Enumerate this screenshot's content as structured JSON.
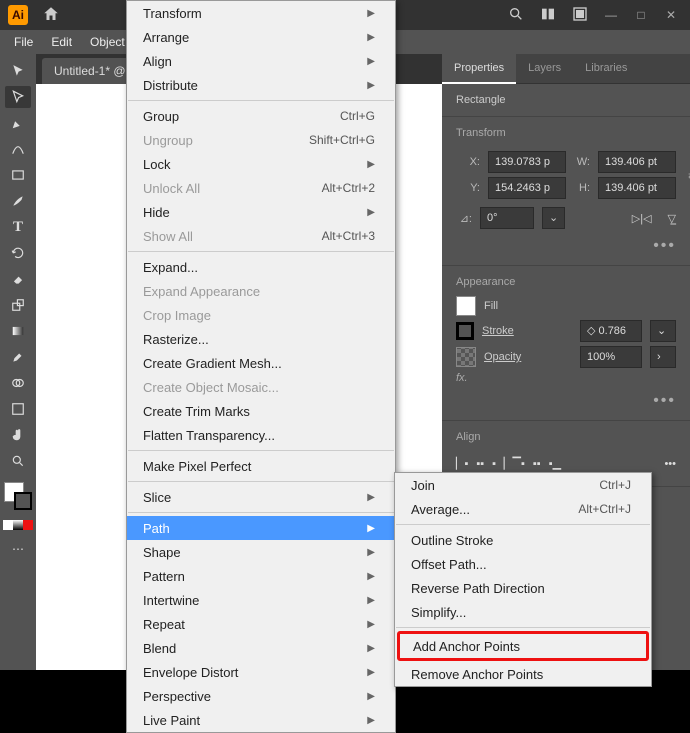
{
  "titlebar": {
    "logo_text": "Ai"
  },
  "menubar": {
    "items": [
      "File",
      "Edit",
      "Object"
    ]
  },
  "doc_tab": "Untitled-1* @",
  "panel": {
    "tabs": [
      "Properties",
      "Layers",
      "Libraries"
    ],
    "shape_type": "Rectangle",
    "transform": {
      "title": "Transform",
      "x_label": "X:",
      "x": "139.0783 p",
      "y_label": "Y:",
      "y": "154.2463 p",
      "w_label": "W:",
      "w": "139.406 pt",
      "h_label": "H:",
      "h": "139.406 pt",
      "angle_label": "⊿:",
      "angle": "0°"
    },
    "appearance": {
      "title": "Appearance",
      "fill": "Fill",
      "stroke": "Stroke",
      "stroke_val": "0.786",
      "opacity": "Opacity",
      "opacity_val": "100%",
      "fx": "fx."
    },
    "align": {
      "title": "Align"
    }
  },
  "main_menu": [
    {
      "label": "Transform",
      "sub": true
    },
    {
      "label": "Arrange",
      "sub": true
    },
    {
      "label": "Align",
      "sub": true
    },
    {
      "label": "Distribute",
      "sub": true
    },
    {
      "sep": true
    },
    {
      "label": "Group",
      "shortcut": "Ctrl+G"
    },
    {
      "label": "Ungroup",
      "shortcut": "Shift+Ctrl+G",
      "disabled": true
    },
    {
      "label": "Lock",
      "sub": true
    },
    {
      "label": "Unlock All",
      "shortcut": "Alt+Ctrl+2",
      "disabled": true
    },
    {
      "label": "Hide",
      "sub": true
    },
    {
      "label": "Show All",
      "shortcut": "Alt+Ctrl+3",
      "disabled": true
    },
    {
      "sep": true
    },
    {
      "label": "Expand..."
    },
    {
      "label": "Expand Appearance",
      "disabled": true
    },
    {
      "label": "Crop Image",
      "disabled": true
    },
    {
      "label": "Rasterize..."
    },
    {
      "label": "Create Gradient Mesh..."
    },
    {
      "label": "Create Object Mosaic...",
      "disabled": true
    },
    {
      "label": "Create Trim Marks"
    },
    {
      "label": "Flatten Transparency..."
    },
    {
      "sep": true
    },
    {
      "label": "Make Pixel Perfect"
    },
    {
      "sep": true
    },
    {
      "label": "Slice",
      "sub": true
    },
    {
      "sep": true
    },
    {
      "label": "Path",
      "sub": true,
      "highlight": true
    },
    {
      "label": "Shape",
      "sub": true
    },
    {
      "label": "Pattern",
      "sub": true
    },
    {
      "label": "Intertwine",
      "sub": true
    },
    {
      "label": "Repeat",
      "sub": true
    },
    {
      "label": "Blend",
      "sub": true
    },
    {
      "label": "Envelope Distort",
      "sub": true
    },
    {
      "label": "Perspective",
      "sub": true
    },
    {
      "label": "Live Paint",
      "sub": true
    }
  ],
  "sub_menu": [
    {
      "label": "Join",
      "shortcut": "Ctrl+J"
    },
    {
      "label": "Average...",
      "shortcut": "Alt+Ctrl+J"
    },
    {
      "sep": true
    },
    {
      "label": "Outline Stroke"
    },
    {
      "label": "Offset Path..."
    },
    {
      "label": "Reverse Path Direction"
    },
    {
      "label": "Simplify..."
    },
    {
      "sep": true
    },
    {
      "label": "Add Anchor Points",
      "boxed": true
    },
    {
      "label": "Remove Anchor Points"
    }
  ]
}
